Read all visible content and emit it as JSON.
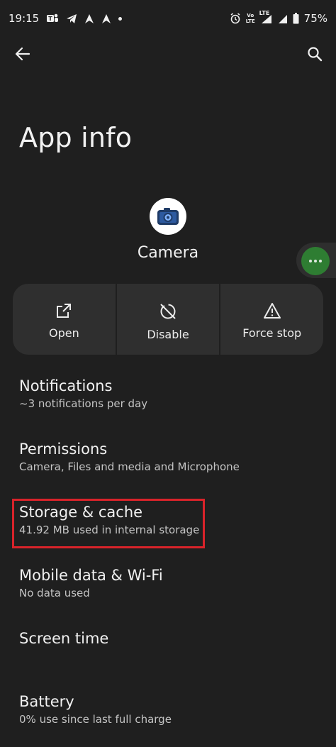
{
  "status_bar": {
    "time": "19:15",
    "network_label_top": "Vo",
    "network_label_bottom": "LTE",
    "lte_label": "LTE",
    "battery": "75%"
  },
  "header": {
    "title": "App info"
  },
  "app": {
    "name": "Camera"
  },
  "actions": [
    {
      "label": "Open",
      "icon": "open-external-icon"
    },
    {
      "label": "Disable",
      "icon": "disable-icon"
    },
    {
      "label": "Force stop",
      "icon": "warning-icon"
    }
  ],
  "settings": [
    {
      "title": "Notifications",
      "subtitle": "~3 notifications per day"
    },
    {
      "title": "Permissions",
      "subtitle": "Camera, Files and media and Microphone"
    },
    {
      "title": "Storage & cache",
      "subtitle": "41.92 MB used in internal storage"
    },
    {
      "title": "Mobile data & Wi-Fi",
      "subtitle": "No data used"
    },
    {
      "title": "Screen time",
      "subtitle": ""
    },
    {
      "title": "Battery",
      "subtitle": "0% use since last full charge"
    }
  ],
  "colors": {
    "background": "#1f1f1f",
    "card": "#2f2f2f",
    "highlight": "#d9232a",
    "bubble": "#2e7d32"
  }
}
